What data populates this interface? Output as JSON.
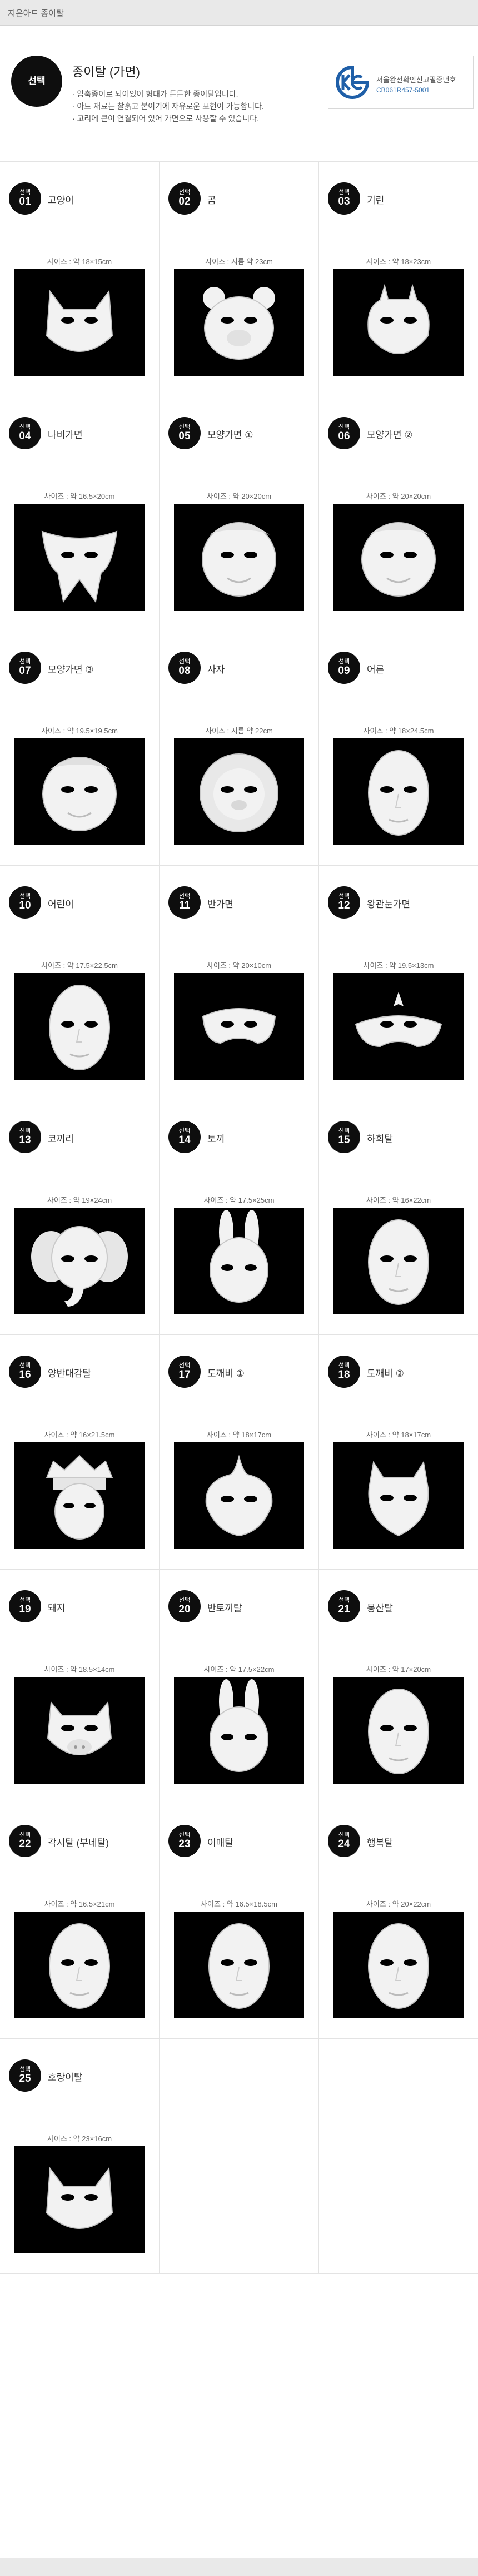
{
  "header": {
    "title": "지은아트 종이탈"
  },
  "intro": {
    "badge": "선택",
    "title": "종이탈 (가면)",
    "lines": [
      "· 압축종이로 되어있어 형태가 튼튼한 종이탈입니다.",
      "· 아트 재료는 찰흙고 붙이기에 자유로운 표현이 가능합니다.",
      "· 고리에 큰이 연결되어 있어 가면으로 사용할 수 있습니다."
    ],
    "kc_text": "저울완전확인신고필증번호",
    "kc_code": "CB061R457-5001"
  },
  "items": [
    {
      "badge": "선택",
      "num": "01",
      "name": "고양이",
      "size": "사이즈 : 약 18×15cm",
      "icon": "cat-mask-photo",
      "shape": "cat"
    },
    {
      "badge": "선택",
      "num": "02",
      "name": "곰",
      "size": "사이즈 : 지름 약 23cm",
      "icon": "bear-mask-photo",
      "shape": "bear"
    },
    {
      "badge": "선택",
      "num": "03",
      "name": "기린",
      "size": "사이즈 : 약 18×23cm",
      "icon": "giraffe-mask-photo",
      "shape": "giraffe"
    },
    {
      "badge": "선택",
      "num": "04",
      "name": "나비가면",
      "size": "사이즈 : 약 16.5×20cm",
      "icon": "butterfly-mask-photo",
      "shape": "butterfly"
    },
    {
      "badge": "선택",
      "num": "05",
      "name": "모양가면 ①",
      "size": "사이즈 : 약 20×20cm",
      "icon": "shape-mask-1-photo",
      "shape": "round"
    },
    {
      "badge": "선택",
      "num": "06",
      "name": "모양가면 ②",
      "size": "사이즈 : 약 20×20cm",
      "icon": "shape-mask-2-photo",
      "shape": "round"
    },
    {
      "badge": "선택",
      "num": "07",
      "name": "모양가면 ③",
      "size": "사이즈 : 약 19.5×19.5cm",
      "icon": "shape-mask-3-photo",
      "shape": "round"
    },
    {
      "badge": "선택",
      "num": "08",
      "name": "사자",
      "size": "사이즈 : 지름 약 22cm",
      "icon": "lion-mask-photo",
      "shape": "lion"
    },
    {
      "badge": "선택",
      "num": "09",
      "name": "어른",
      "size": "사이즈 : 약 18×24.5cm",
      "icon": "adult-face-mask-photo",
      "shape": "face"
    },
    {
      "badge": "선택",
      "num": "10",
      "name": "어린이",
      "size": "사이즈 : 약 17.5×22.5cm",
      "icon": "child-face-mask-photo",
      "shape": "face"
    },
    {
      "badge": "선택",
      "num": "11",
      "name": "반가면",
      "size": "사이즈 : 약 20×10cm",
      "icon": "half-mask-photo",
      "shape": "half"
    },
    {
      "badge": "선택",
      "num": "12",
      "name": "왕관눈가면",
      "size": "사이즈 : 약 19.5×13cm",
      "icon": "crown-eye-mask-photo",
      "shape": "crown"
    },
    {
      "badge": "선택",
      "num": "13",
      "name": "코끼리",
      "size": "사이즈 : 약 19×24cm",
      "icon": "elephant-mask-photo",
      "shape": "elephant"
    },
    {
      "badge": "선택",
      "num": "14",
      "name": "토끼",
      "size": "사이즈 : 약 17.5×25cm",
      "icon": "rabbit-mask-photo",
      "shape": "rabbit"
    },
    {
      "badge": "선택",
      "num": "15",
      "name": "하회탈",
      "size": "사이즈 : 약 16×22cm",
      "icon": "hahoe-mask-photo",
      "shape": "face"
    },
    {
      "badge": "선택",
      "num": "16",
      "name": "양반대감탈",
      "size": "사이즈 : 약 16×21.5cm",
      "icon": "yangban-mask-photo",
      "shape": "hat"
    },
    {
      "badge": "선택",
      "num": "17",
      "name": "도깨비 ①",
      "size": "사이즈 : 약 18×17cm",
      "icon": "goblin-mask-1-photo",
      "shape": "goblin"
    },
    {
      "badge": "선택",
      "num": "18",
      "name": "도깨비 ②",
      "size": "사이즈 : 약 18×17cm",
      "icon": "goblin-mask-2-photo",
      "shape": "goblin2"
    },
    {
      "badge": "선택",
      "num": "19",
      "name": "돼지",
      "size": "사이즈 : 약 18.5×14cm",
      "icon": "pig-mask-photo",
      "shape": "pig"
    },
    {
      "badge": "선택",
      "num": "20",
      "name": "반토끼탈",
      "size": "사이즈 : 약 17.5×22cm",
      "icon": "half-rabbit-mask-photo",
      "shape": "rabbit"
    },
    {
      "badge": "선택",
      "num": "21",
      "name": "봉산탈",
      "size": "사이즈 : 약 17×20cm",
      "icon": "bongsan-mask-photo",
      "shape": "face"
    },
    {
      "badge": "선택",
      "num": "22",
      "name": "각시탈 (부네탈)",
      "size": "사이즈 : 약 16.5×21cm",
      "icon": "gaksi-mask-photo",
      "shape": "face"
    },
    {
      "badge": "선택",
      "num": "23",
      "name": "이매탈",
      "size": "사이즈 : 약 16.5×18.5cm",
      "icon": "imae-mask-photo",
      "shape": "face"
    },
    {
      "badge": "선택",
      "num": "24",
      "name": "행복탈",
      "size": "사이즈 : 약 20×22cm",
      "icon": "happy-mask-photo",
      "shape": "face"
    },
    {
      "badge": "선택",
      "num": "25",
      "name": "호랑이탈",
      "size": "사이즈 : 약 23×16cm",
      "icon": "tiger-mask-photo",
      "shape": "cat"
    }
  ]
}
